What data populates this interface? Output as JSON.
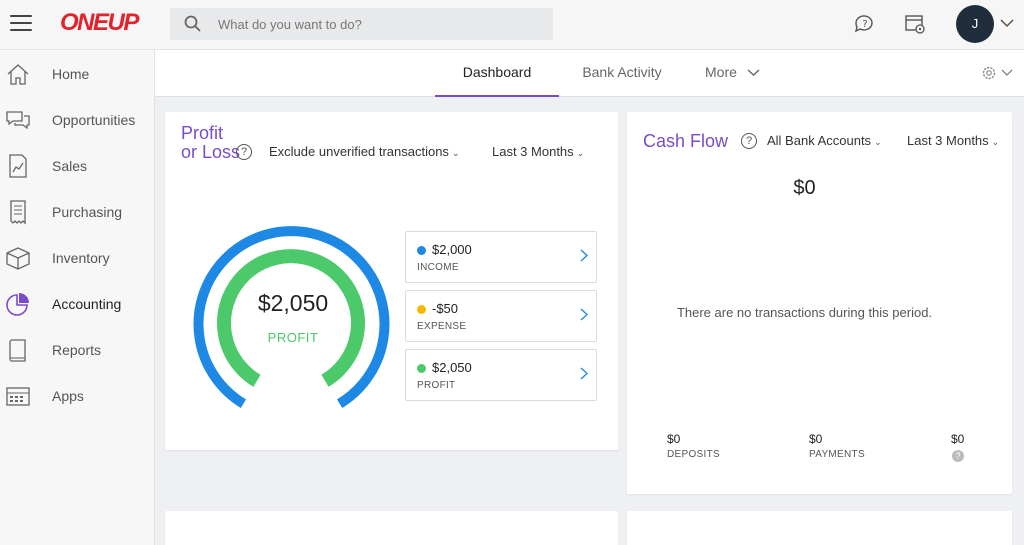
{
  "app": {
    "logo_text": "ONEUP",
    "search_placeholder": "What do you want to do?",
    "user_initial": "J"
  },
  "sidebar": {
    "items": [
      {
        "label": "Home",
        "icon": "home-icon"
      },
      {
        "label": "Opportunities",
        "icon": "chat-bubbles-icon"
      },
      {
        "label": "Sales",
        "icon": "sales-chart-icon"
      },
      {
        "label": "Purchasing",
        "icon": "receipt-icon"
      },
      {
        "label": "Inventory",
        "icon": "box-icon"
      },
      {
        "label": "Accounting",
        "icon": "pie-chart-icon"
      },
      {
        "label": "Reports",
        "icon": "book-icon"
      },
      {
        "label": "Apps",
        "icon": "apps-grid-icon"
      }
    ],
    "active": "Accounting"
  },
  "tabs": {
    "dashboard": "Dashboard",
    "bank_activity": "Bank Activity",
    "more": "More"
  },
  "profit_loss": {
    "title": "Profit or Loss",
    "filter": "Exclude unverified transactions",
    "period": "Last 3 Months",
    "center_amount": "$2,050",
    "center_label": "PROFIT",
    "rows": [
      {
        "amount": "$2,000",
        "label": "INCOME",
        "color": "#1e88e5"
      },
      {
        "amount": "-$50",
        "label": "EXPENSE",
        "color": "#f5b800"
      },
      {
        "amount": "$2,050",
        "label": "PROFIT",
        "color": "#4cc96a"
      }
    ],
    "colors": {
      "income": "#1e88e5",
      "profit": "#4cc96a",
      "accent": "#7a4cc9"
    }
  },
  "cash_flow": {
    "title": "Cash Flow",
    "accounts": "All Bank Accounts",
    "period": "Last 3 Months",
    "total": "$0",
    "empty_message": "There are no transactions during this period.",
    "deposits": {
      "value": "$0",
      "label": "DEPOSITS"
    },
    "payments": {
      "value": "$0",
      "label": "PAYMENTS"
    },
    "net": {
      "value": "$0"
    }
  }
}
